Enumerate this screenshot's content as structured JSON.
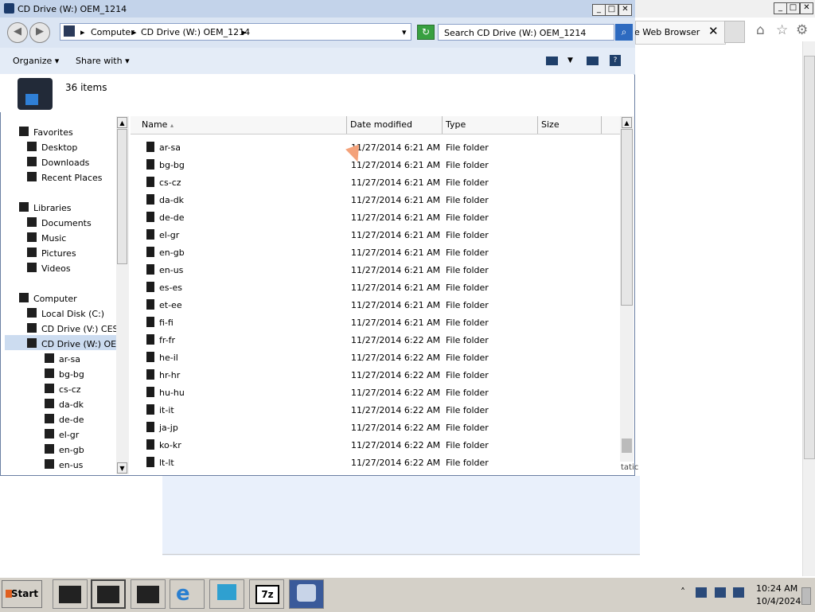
{
  "background_browser": {
    "tab_title": "ne Web Browser",
    "tab_close": "✕",
    "tools": [
      "home-icon",
      "star-icon",
      "gear-icon"
    ]
  },
  "explorer": {
    "title": "CD Drive (W:) OEM_1214",
    "title_buttons": {
      "minimize": "_",
      "maximize": "□",
      "close": "✕"
    },
    "nav": {
      "back": "◀",
      "forward": "▶"
    },
    "breadcrumb": [
      "Computer",
      "CD Drive (W:) OEM_1214"
    ],
    "breadcrumb_sep": "▸",
    "address_dropdown": "▾",
    "refresh": "↻",
    "search_placeholder": "Search CD Drive (W:) OEM_1214",
    "search_icon": "⌕",
    "commands": {
      "organize": "Organize ▾",
      "share": "Share with ▾"
    },
    "help": "?",
    "item_count": "36 items",
    "columns": {
      "name": "Name",
      "date": "Date modified",
      "type": "Type",
      "size": "Size"
    },
    "sort_glyph": "▴",
    "nav_pane": [
      {
        "label": "Favorites",
        "indent": 0,
        "kind": "section"
      },
      {
        "label": "Desktop",
        "indent": 1
      },
      {
        "label": "Downloads",
        "indent": 1
      },
      {
        "label": "Recent Places",
        "indent": 1
      },
      {
        "label": "Libraries",
        "indent": 0,
        "kind": "section"
      },
      {
        "label": "Documents",
        "indent": 1
      },
      {
        "label": "Music",
        "indent": 1
      },
      {
        "label": "Pictures",
        "indent": 1
      },
      {
        "label": "Videos",
        "indent": 1
      },
      {
        "label": "Computer",
        "indent": 0,
        "kind": "section"
      },
      {
        "label": "Local Disk (C:)",
        "indent": 1
      },
      {
        "label": "CD Drive (V:) CES_",
        "indent": 1
      },
      {
        "label": "CD Drive (W:) OEM",
        "indent": 1,
        "selected": true
      },
      {
        "label": "ar-sa",
        "indent": 2
      },
      {
        "label": "bg-bg",
        "indent": 2
      },
      {
        "label": "cs-cz",
        "indent": 2
      },
      {
        "label": "da-dk",
        "indent": 2
      },
      {
        "label": "de-de",
        "indent": 2
      },
      {
        "label": "el-gr",
        "indent": 2
      },
      {
        "label": "en-gb",
        "indent": 2
      },
      {
        "label": "en-us",
        "indent": 2
      }
    ],
    "files": [
      {
        "name": "ar-sa",
        "date": "11/27/2014 6:21 AM",
        "type": "File folder"
      },
      {
        "name": "bg-bg",
        "date": "11/27/2014 6:21 AM",
        "type": "File folder"
      },
      {
        "name": "cs-cz",
        "date": "11/27/2014 6:21 AM",
        "type": "File folder"
      },
      {
        "name": "da-dk",
        "date": "11/27/2014 6:21 AM",
        "type": "File folder"
      },
      {
        "name": "de-de",
        "date": "11/27/2014 6:21 AM",
        "type": "File folder"
      },
      {
        "name": "el-gr",
        "date": "11/27/2014 6:21 AM",
        "type": "File folder"
      },
      {
        "name": "en-gb",
        "date": "11/27/2014 6:21 AM",
        "type": "File folder"
      },
      {
        "name": "en-us",
        "date": "11/27/2014 6:21 AM",
        "type": "File folder"
      },
      {
        "name": "es-es",
        "date": "11/27/2014 6:21 AM",
        "type": "File folder"
      },
      {
        "name": "et-ee",
        "date": "11/27/2014 6:21 AM",
        "type": "File folder"
      },
      {
        "name": "fi-fi",
        "date": "11/27/2014 6:21 AM",
        "type": "File folder"
      },
      {
        "name": "fr-fr",
        "date": "11/27/2014 6:22 AM",
        "type": "File folder"
      },
      {
        "name": "he-il",
        "date": "11/27/2014 6:22 AM",
        "type": "File folder"
      },
      {
        "name": "hr-hr",
        "date": "11/27/2014 6:22 AM",
        "type": "File folder"
      },
      {
        "name": "hu-hu",
        "date": "11/27/2014 6:22 AM",
        "type": "File folder"
      },
      {
        "name": "it-it",
        "date": "11/27/2014 6:22 AM",
        "type": "File folder"
      },
      {
        "name": "ja-jp",
        "date": "11/27/2014 6:22 AM",
        "type": "File folder"
      },
      {
        "name": "ko-kr",
        "date": "11/27/2014 6:22 AM",
        "type": "File folder"
      },
      {
        "name": "lt-lt",
        "date": "11/27/2014 6:22 AM",
        "type": "File folder"
      }
    ],
    "status_fragment": "tatic"
  },
  "taskbar": {
    "start_label": "Start",
    "tray_expand": "˄",
    "time": "10:24 AM",
    "date": "10/4/2024",
    "seven_zip_label": "7z"
  }
}
